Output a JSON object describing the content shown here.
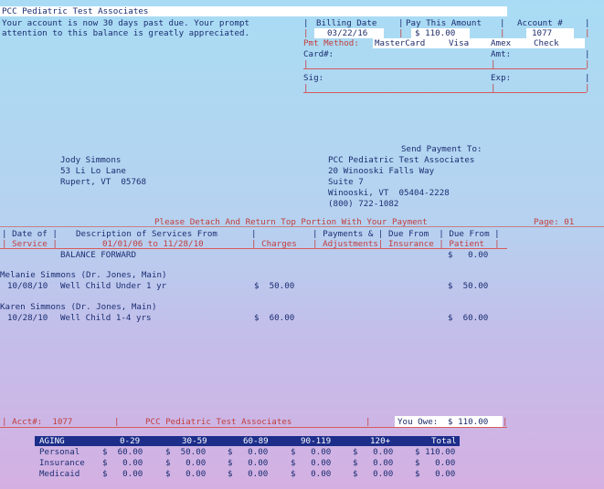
{
  "title": "PCC Pediatric Test Associates",
  "notice": [
    "Your account is now 30 days past due. Your prompt",
    "attention to this balance is greatly appreciated."
  ],
  "header": {
    "billing_date_label": "Billing Date",
    "billing_date": "03/22/16",
    "pay_label": "Pay This Amount",
    "pay_amount": "$ 110.00",
    "account_label": "Account #",
    "account": "1077"
  },
  "payment": {
    "method_label": "Pmt Method:",
    "methods": [
      "MasterCard",
      "Visa",
      "Amex",
      "Check"
    ],
    "card_label": "Card#:",
    "amt_label": "Amt:",
    "sig_label": "Sig:",
    "exp_label": "Exp:"
  },
  "patient_address": [
    "Jody Simmons",
    "53 Li Lo Lane",
    "Rupert, VT  05768"
  ],
  "remit": {
    "label": "Send Payment To:",
    "lines": [
      "PCC Pediatric Test Associates",
      "20 Winooski Falls Way",
      "Suite 7",
      "Winooski, VT  05404-2228",
      "(800) 722-1082"
    ]
  },
  "detach_text": "Please Detach And Return Top Portion With Your Payment",
  "page_label": "Page: 01",
  "table": {
    "h1_date": "| Date of |",
    "h1_desc": "Description of Services From",
    "h1_pay": "| Payments & | Due From  | Due From |",
    "h2_service": "| Service |",
    "h2_range": "01/01/06 to 11/28/10",
    "h2_charges": "| Charges",
    "h2_adj": "| Adjustments| Insurance | Patient  |"
  },
  "balance_forward": {
    "label": "BALANCE FORWARD",
    "patient": "$   0.00"
  },
  "entries": [
    {
      "patient": "Melanie Simmons (Dr. Jones, Main)",
      "date": "10/08/10",
      "desc": "Well Child Under 1 yr",
      "charge": "$  50.00",
      "due": "$  50.00"
    },
    {
      "patient": "Karen Simmons (Dr. Jones, Main)",
      "date": "10/28/10",
      "desc": "Well Child 1-4 yrs",
      "charge": "$  60.00",
      "due": "$  60.00"
    }
  ],
  "footer": {
    "acct_label": "| Acct#:  1077",
    "practice": "PCC Pediatric Test Associates",
    "owe_label": "You Owe:",
    "owe_amount": "$ 110.00"
  },
  "aging": {
    "headers": [
      "AGING",
      "0-29",
      "30-59",
      "60-89",
      "90-119",
      "120+",
      "Total"
    ],
    "rows": [
      {
        "label": "Personal",
        "values": [
          "$  60.00",
          "$  50.00",
          "$   0.00",
          "$   0.00",
          "$   0.00",
          "$ 110.00"
        ]
      },
      {
        "label": "Insurance",
        "values": [
          "$   0.00",
          "$   0.00",
          "$   0.00",
          "$   0.00",
          "$   0.00",
          "$   0.00"
        ]
      },
      {
        "label": "Medicaid",
        "values": [
          "$   0.00",
          "$   0.00",
          "$   0.00",
          "$   0.00",
          "$   0.00",
          "$   0.00"
        ]
      }
    ]
  }
}
